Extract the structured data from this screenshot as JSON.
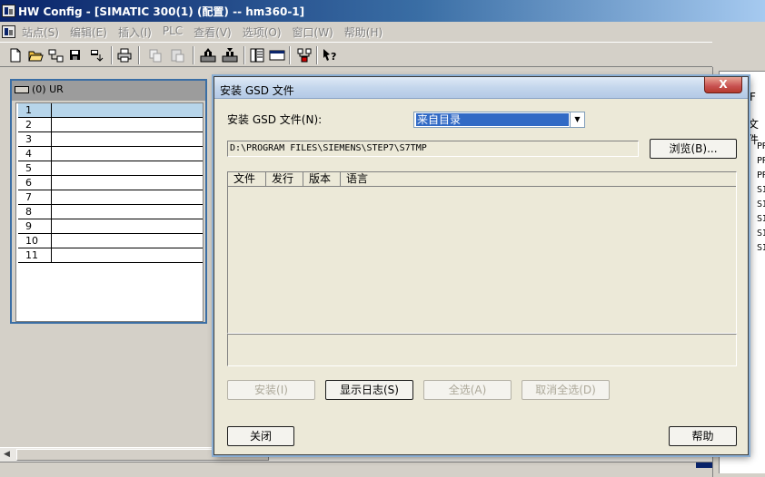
{
  "window": {
    "title": "HW Config - [SIMATIC 300(1) (配置) -- hm360-1]"
  },
  "menu": {
    "items": [
      "站点(S)",
      "编辑(E)",
      "插入(I)",
      "PLC",
      "查看(V)",
      "选项(O)",
      "窗口(W)",
      "帮助(H)"
    ]
  },
  "toolbar": {
    "icons": [
      "new-icon",
      "open-icon",
      "save-icon",
      "save-compile-icon",
      "download-icon",
      "print-icon",
      "copy-icon",
      "paste-icon",
      "upload-icon",
      "download-module-icon",
      "catalog-icon",
      "monitor-icon",
      "network-icon",
      "help-context-icon"
    ]
  },
  "rack": {
    "label": "(0) UR",
    "slots": [
      "1",
      "2",
      "3",
      "4",
      "5",
      "6",
      "7",
      "8",
      "9",
      "10",
      "11"
    ]
  },
  "right_panel": {
    "label_top": "F",
    "label_file": "文件",
    "items": [
      "PR",
      "PR",
      "PR",
      "SI",
      "SI",
      "SI",
      "SI",
      "SI"
    ]
  },
  "dialog": {
    "title": "安装 GSD 文件",
    "install_label": "安装 GSD 文件(N):",
    "source_value": "来自目录",
    "path_value": "D:\\PROGRAM FILES\\SIEMENS\\STEP7\\S7TMP",
    "browse_label": "浏览(B)...",
    "columns": [
      "文件",
      "发行",
      "版本",
      "语言"
    ],
    "install_button": "安装(I)",
    "show_log_button": "显示日志(S)",
    "select_all_button": "全选(A)",
    "deselect_all_button": "取消全选(D)",
    "close_button": "关闭",
    "help_button": "帮助",
    "close_x": "X"
  },
  "colors": {
    "title_gradient_start": "#0a246a",
    "selection": "#316ac5",
    "slot_highlight": "#b7d5ea",
    "dialog_bg": "#ece9d8"
  }
}
